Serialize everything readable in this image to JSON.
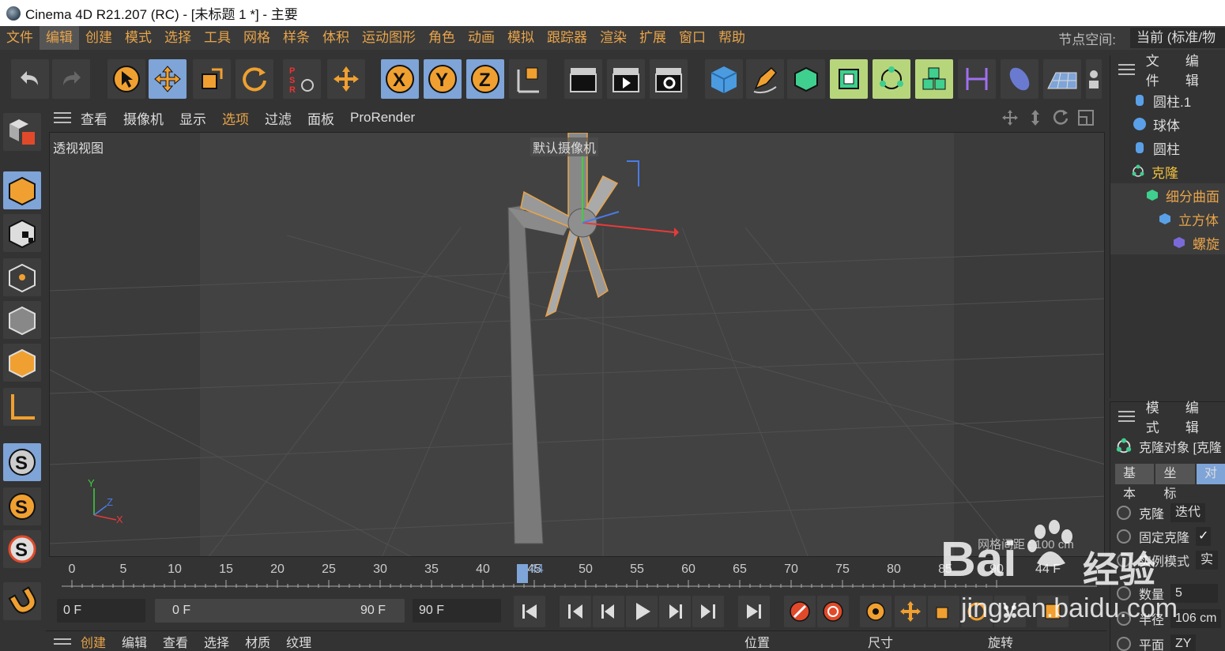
{
  "window": {
    "title": "Cinema 4D R21.207 (RC) - [未标题 1 *] - 主要"
  },
  "menu": {
    "items": [
      "文件",
      "编辑",
      "创建",
      "模式",
      "选择",
      "工具",
      "网格",
      "样条",
      "体积",
      "运动图形",
      "角色",
      "动画",
      "模拟",
      "跟踪器",
      "渲染",
      "扩展",
      "窗口",
      "帮助"
    ],
    "active_index": 1,
    "node_space_label": "节点空间:",
    "node_space_value": "当前 (标准/物"
  },
  "viewport_menu": {
    "items": [
      "查看",
      "摄像机",
      "显示",
      "选项",
      "过滤",
      "面板",
      "ProRender"
    ],
    "active_index": 3
  },
  "viewport": {
    "view_label": "透视视图",
    "camera_label": "默认摄像机",
    "grid_info": "网格间距 : 100 cm",
    "axis_labels": {
      "x": "X",
      "y": "Y",
      "z": "Z"
    }
  },
  "timeline": {
    "ticks": [
      "0",
      "5",
      "10",
      "15",
      "20",
      "25",
      "30",
      "35",
      "40",
      "45",
      "50",
      "55",
      "60",
      "65",
      "70",
      "75",
      "80",
      "85",
      "90"
    ],
    "current_frame": "44",
    "end_frame_label": "44 F"
  },
  "transport": {
    "current": "0 F",
    "range_start": "0 F",
    "range_end": "90 F",
    "end": "90 F"
  },
  "bottom_menu": {
    "items": [
      "创建",
      "编辑",
      "查看",
      "选择",
      "材质",
      "纹理"
    ],
    "active_index": 0,
    "coord_headers": [
      "位置",
      "尺寸",
      "旋转"
    ]
  },
  "object_manager": {
    "menu": [
      "文件",
      "编辑"
    ],
    "objects": [
      {
        "name": "圆柱.1",
        "icon": "cylinder-icon",
        "color": "#dddddd"
      },
      {
        "name": "球体",
        "icon": "sphere-icon",
        "color": "#dddddd"
      },
      {
        "name": "圆柱",
        "icon": "cylinder-icon",
        "color": "#dddddd"
      },
      {
        "name": "克隆",
        "icon": "cloner-icon",
        "color": "#f0c040"
      },
      {
        "name": "细分曲面",
        "icon": "subdivision-icon",
        "color": "#e8a44a"
      },
      {
        "name": "立方体",
        "icon": "cube-icon",
        "color": "#e8a44a"
      },
      {
        "name": "螺旋",
        "icon": "twist-icon",
        "color": "#e8a44a"
      }
    ]
  },
  "attributes": {
    "menu": [
      "模式",
      "编辑"
    ],
    "object_title": "克隆对象 [克隆",
    "tabs": [
      "基本",
      "坐标",
      "对"
    ],
    "rows": [
      {
        "label": "克隆",
        "value": "迭代"
      },
      {
        "label": "固定克隆",
        "value": "✓"
      },
      {
        "label": "实例模式",
        "value": "实"
      },
      {
        "label": "数量",
        "value": "5"
      },
      {
        "label": "半径",
        "value": "106 cm"
      },
      {
        "label": "平面",
        "value": "ZY"
      }
    ]
  },
  "watermark": {
    "brand": "Bai",
    "suffix": "经验",
    "url": "jingyan.baidu.com"
  },
  "colors": {
    "accent": "#e8a44a",
    "selected": "#7ea4d8",
    "highlight": "#b7d67c"
  }
}
